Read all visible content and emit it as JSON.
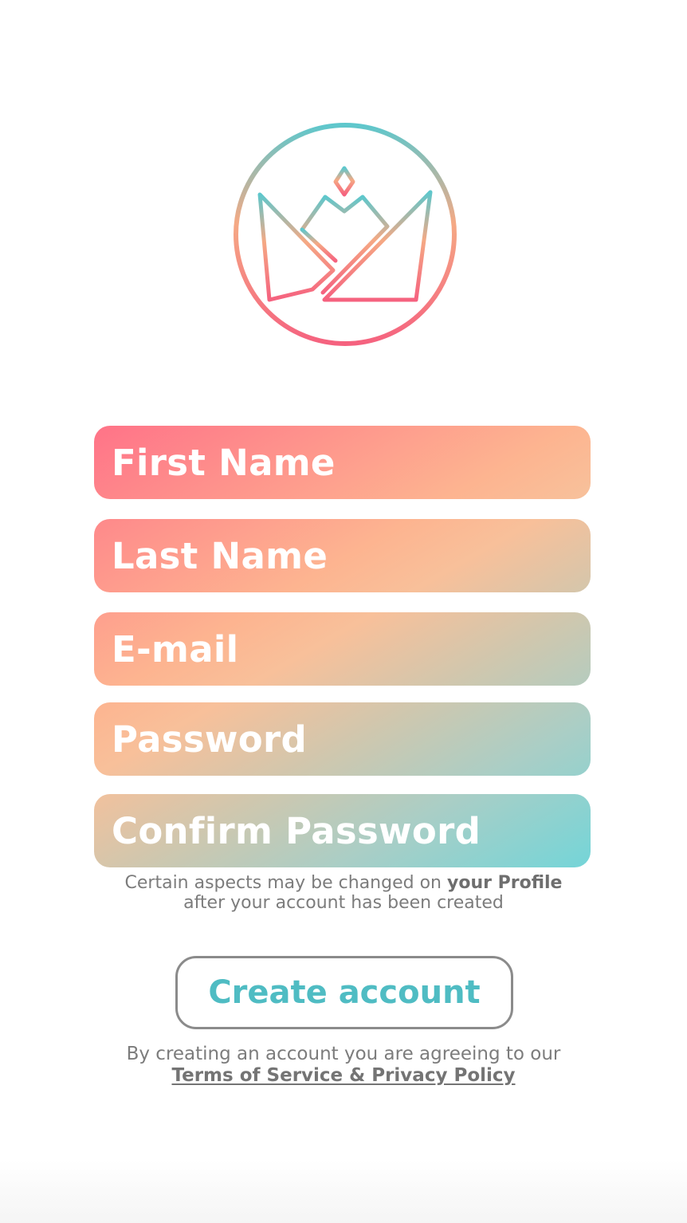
{
  "colors": {
    "gradient_start": "#ff7388",
    "gradient_mid": "#f8c09a",
    "gradient_end": "#74d5d8",
    "button_text": "#4fbcc3",
    "button_border": "#8b8b8b",
    "muted_text": "#7c7c7c"
  },
  "logo": {
    "icon": "crown-logo-icon"
  },
  "form": {
    "first_name_placeholder": "First Name",
    "last_name_placeholder": "Last Name",
    "email_placeholder": "E-mail",
    "password_placeholder": "Password",
    "confirm_password_placeholder": "Confirm Password"
  },
  "hint": {
    "line1_prefix": "Certain aspects may be changed on ",
    "line1_bold": "your Profile",
    "line2": "after your account has been created"
  },
  "create_button": {
    "label": "Create account"
  },
  "terms": {
    "text": "By creating an account you are agreeing to our",
    "link": "Terms of Service & Privacy Policy"
  }
}
